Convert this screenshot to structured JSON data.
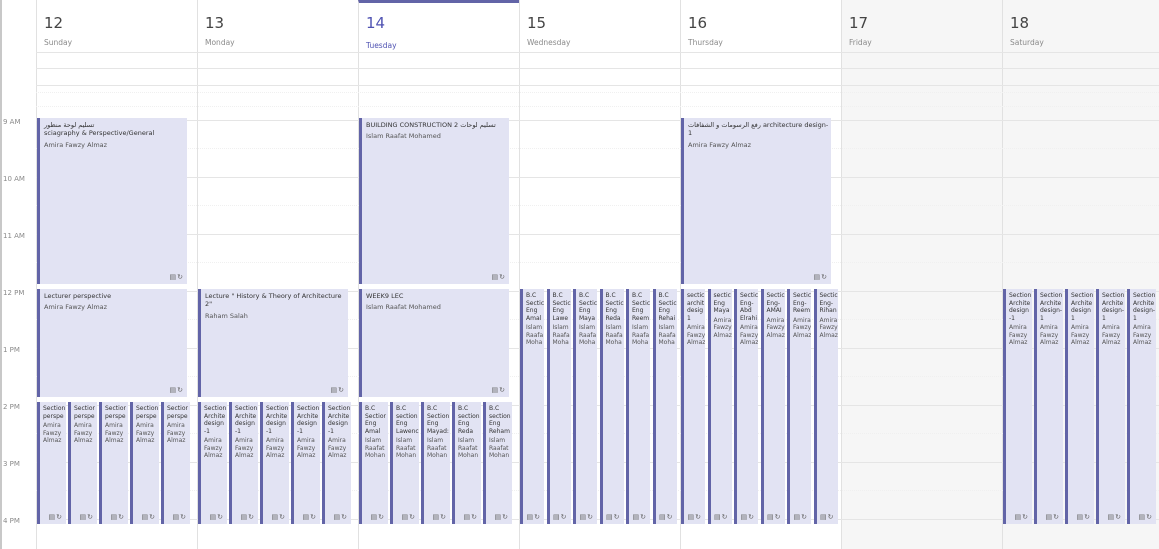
{
  "days": [
    {
      "num": "12",
      "name": "Sunday"
    },
    {
      "num": "13",
      "name": "Monday"
    },
    {
      "num": "14",
      "name": "Tuesday"
    },
    {
      "num": "15",
      "name": "Wednesday"
    },
    {
      "num": "16",
      "name": "Thursday"
    },
    {
      "num": "17",
      "name": "Friday"
    },
    {
      "num": "18",
      "name": "Saturday"
    }
  ],
  "times": [
    "9 AM",
    "10 AM",
    "11 AM",
    "12 PM",
    "1 PM",
    "2 PM",
    "3 PM",
    "4 PM"
  ],
  "event_icons": "▤↻",
  "events": {
    "sun_am": {
      "title": "تسليم لوحة منظور\nsciagraphy & Perspective/General",
      "organizer": "Amira Fawzy Almaz"
    },
    "sun_noon": {
      "title": "Lecturer perspective",
      "organizer": "Amira Fawzy Almaz"
    },
    "mon_noon": {
      "title": "Lecture \" History & Theory of Architecture 2\"",
      "organizer": "Raham Salah"
    },
    "tue_am": {
      "title": "BUILDING CONSTRUCTION 2 تسليم لوحات",
      "organizer": "Islam Raafat Mohamed"
    },
    "tue_noon": {
      "title": "WEEK9 LEC",
      "organizer": "Islam Raafat Mohamed"
    },
    "thu_am": {
      "title": "رفع الرسومات و الشفافات architecture design-1",
      "organizer": "Amira Fawzy Almaz"
    },
    "sun_pm": [
      {
        "t": "Section\nperspe",
        "o": "Amira\nFawzy\nAlmaz"
      },
      {
        "t": "Sectior\nperspe",
        "o": "Amira\nFawzy\nAlmaz"
      },
      {
        "t": "Sectior\nperspe",
        "o": "Amira\nFawzy\nAlmaz"
      },
      {
        "t": "Section\nperspe",
        "o": "Amira\nFawzy\nAlmaz"
      },
      {
        "t": "Sectior\nperspe",
        "o": "Amira\nFawzy\nAlmaz"
      }
    ],
    "mon_pm": [
      {
        "t": "Section\nArchite\ndesign\n-1",
        "o": "Amira\nFawzy\nAlmaz"
      },
      {
        "t": "Section\nArchite\ndesign\n-1",
        "o": "Amira\nFawzy\nAlmaz"
      },
      {
        "t": "Section\nArchite\ndesign\n-1",
        "o": "Amira\nFawzy\nAlmaz"
      },
      {
        "t": "Section\nArchite\ndesign\n-1",
        "o": "Amira\nFawzy\nAlmaz"
      },
      {
        "t": "Section\nArchite\ndesign\n-1",
        "o": "Amira\nFawzy\nAlmaz"
      }
    ],
    "tue_pm": [
      {
        "t": "B.C\nSectior\nEng\nAmal",
        "o": "Islam\nRaafat\nMohan"
      },
      {
        "t": "B.C\nsection\nEng\nLawenc",
        "o": "Islam\nRaafat\nMohan"
      },
      {
        "t": "B.C\nSection\nEng\nMayad:",
        "o": "Islam\nRaafat\nMohan"
      },
      {
        "t": "B.C\nsection\nEng\nReda",
        "o": "Islam\nRaafat\nMohan"
      },
      {
        "t": "B.C\nsection\nEng\nReham",
        "o": "Islam\nRaafat\nMohan"
      }
    ],
    "wed_pm": [
      {
        "t": "B.C\nSectic\nEng\nAmal",
        "o": "Islam\nRaafa\nMoha"
      },
      {
        "t": "B.C\nSectic\nEng\nLawe",
        "o": "Islam\nRaafa\nMoha"
      },
      {
        "t": "B.C\nSectic\nEng\nMaya",
        "o": "Islam\nRaafa\nMoha"
      },
      {
        "t": "B.C\nSectic\nEng\nReda",
        "o": "Islam\nRaafa\nMoha"
      },
      {
        "t": "B.C\nSectic\nEng\nReem",
        "o": "Islam\nRaafa\nMoha"
      },
      {
        "t": "B.C\nSectic\nEng\nRehai",
        "o": "Islam\nRaafa\nMoha"
      }
    ],
    "thu_pm": [
      {
        "t": "sectic\narchit\ndesig\n1",
        "o": "Amira\nFawzy\nAlmaz"
      },
      {
        "t": "sectic\nEng\nMaya",
        "o": "Amira\nFawzy\nAlmaz"
      },
      {
        "t": "Sectic\nEng-\nAbd\nElrahi",
        "o": "Amira\nFawzy\nAlmaz"
      },
      {
        "t": "Sectic\nEng-\nAMAI",
        "o": "Amira\nFawzy\nAlmaz"
      },
      {
        "t": "Sectic\nEng-\nReem",
        "o": "Amira\nFawzy\nAlmaz"
      },
      {
        "t": "Sectic\nEng-\nRihan",
        "o": "Amira\nFawzy\nAlmaz"
      }
    ],
    "sat_noon": [
      {
        "t": "Section\nArchite\ndesign\n-1",
        "o": "Amira\nFawzy\nAlmaz"
      },
      {
        "t": "Section\nArchite\ndesign-\n1",
        "o": "Amira\nFawzy\nAlmaz"
      },
      {
        "t": "Section\nArchite\ndesign\n1",
        "o": "Amira\nFawzy\nAlmaz"
      },
      {
        "t": "Section\nArchite\ndesign-\n1",
        "o": "Amira\nFawzy\nAlmaz"
      },
      {
        "t": "Section\nArchite\ndesign-\n1",
        "o": "Amira\nFawzy\nAlmaz"
      }
    ]
  }
}
